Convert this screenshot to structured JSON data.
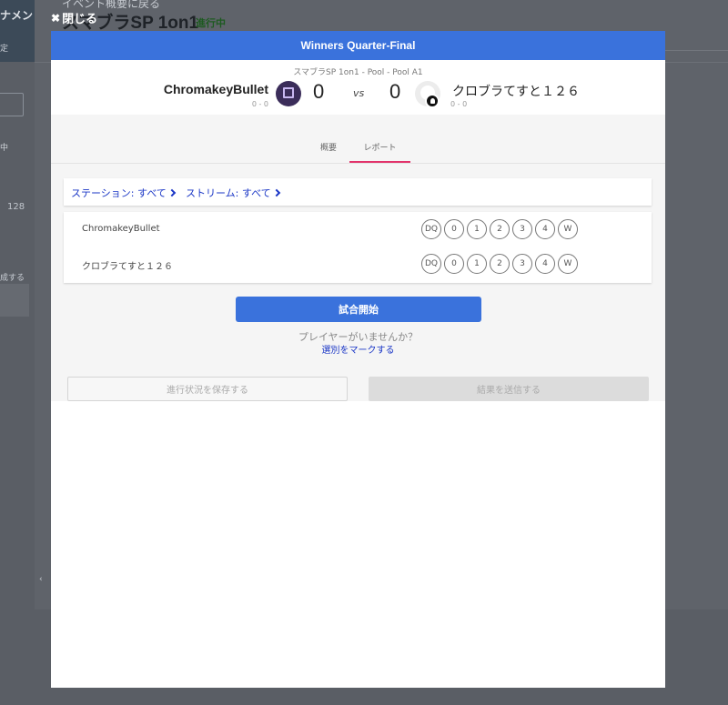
{
  "background": {
    "sidebar_title": "ナメン",
    "sidebar_sub": "定",
    "sidebar_note": "中    ",
    "sidebar_num": "128",
    "sidebar_link": "成する",
    "back_link": "イベント概要に戻る",
    "page_title": "スマブラSP 1on1",
    "status": "進行中"
  },
  "close_label": "閉じる",
  "modal": {
    "header_title": "Winners Quarter-Final",
    "match_path": "スマブラSP 1on1 - Pool - Pool A1",
    "player1": {
      "name": "ChromakeyBullet",
      "record": "0 - 0",
      "score": "0"
    },
    "vs_label": "vs",
    "player2": {
      "name": "クロブラてすと１２６",
      "record": "0 - 0",
      "score": "0"
    },
    "tabs": [
      {
        "label": "概要",
        "active": false
      },
      {
        "label": "レポート",
        "active": true
      }
    ],
    "filters": {
      "station": "ステーション: すべて",
      "stream": "ストリーム: すべて"
    },
    "report_rows": [
      {
        "name": "ChromakeyBullet",
        "options": [
          "DQ",
          "0",
          "1",
          "2",
          "3",
          "4",
          "W"
        ]
      },
      {
        "name": "クロブラてすと１２６",
        "options": [
          "DQ",
          "0",
          "1",
          "2",
          "3",
          "4",
          "W"
        ]
      }
    ],
    "start_button": "試合開始",
    "no_player_text": "プレイヤーがいませんか？",
    "mark_link": "選別をマークする",
    "save_button": "進行状況を保存する",
    "submit_button": "結果を送信する"
  },
  "colors": {
    "accent": "#3a72dc",
    "tab_indicator": "#e2336b",
    "link": "#1a36c6"
  }
}
